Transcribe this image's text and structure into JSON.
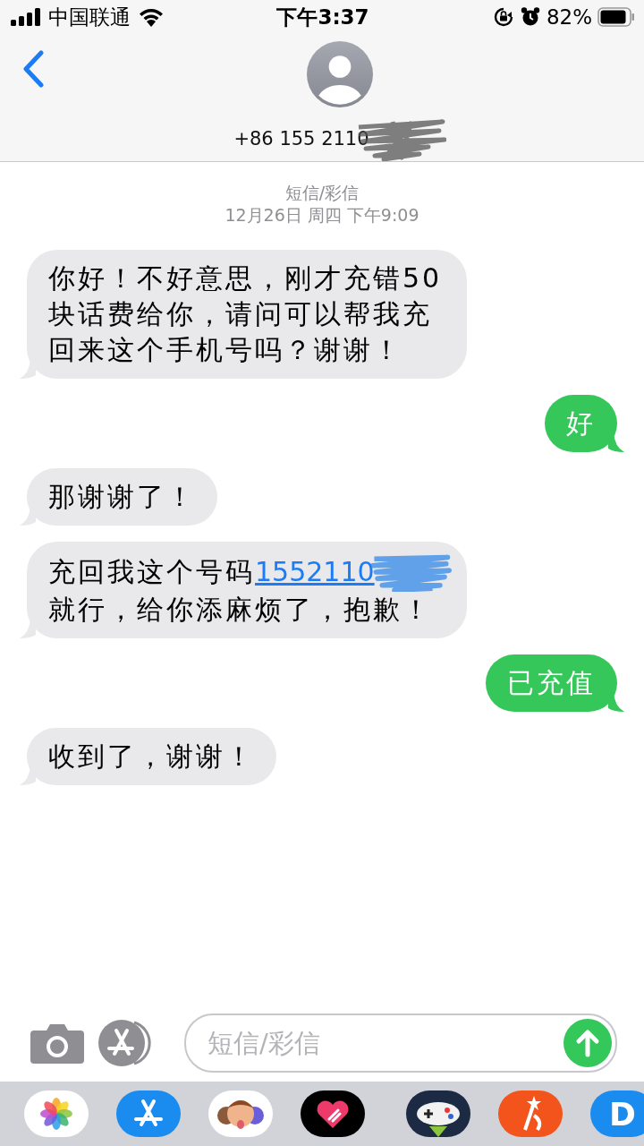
{
  "status_bar": {
    "carrier": "中国联通",
    "time": "下午3:37",
    "battery": "82%"
  },
  "header": {
    "contact": "+86 155 2110",
    "redacted": true
  },
  "thread": {
    "service": "短信/彩信",
    "timestamp": "12月26日 周四 下午9:09"
  },
  "messages": [
    {
      "kind": "incoming",
      "parts": [
        {
          "kind": "text",
          "text": "你好！不好意思，刚才充错50块话费给你，请问可以帮我充回来这个手机号吗？谢谢！"
        }
      ]
    },
    {
      "kind": "outgoing",
      "parts": [
        {
          "kind": "text",
          "text": "好"
        }
      ]
    },
    {
      "kind": "incoming",
      "parts": [
        {
          "kind": "text",
          "text": "那谢谢了！"
        }
      ]
    },
    {
      "kind": "incoming",
      "parts": [
        {
          "kind": "text",
          "text": "充回我这个号码"
        },
        {
          "kind": "link",
          "text": "1552110",
          "redacted": true
        },
        {
          "kind": "text",
          "text": "就行，给你添麻烦了，抱歉！"
        }
      ]
    },
    {
      "kind": "outgoing",
      "parts": [
        {
          "kind": "text",
          "text": "已充值"
        }
      ]
    },
    {
      "kind": "incoming",
      "parts": [
        {
          "kind": "text",
          "text": "收到了，谢谢！"
        }
      ]
    }
  ],
  "composer": {
    "placeholder": "短信/彩信"
  },
  "app_drawer": [
    {
      "kind": "photos"
    },
    {
      "kind": "appstore"
    },
    {
      "kind": "memoji"
    },
    {
      "kind": "heart"
    },
    {
      "kind": "divider"
    },
    {
      "kind": "game"
    },
    {
      "kind": "video"
    },
    {
      "kind": "letter",
      "text": "D"
    }
  ]
}
